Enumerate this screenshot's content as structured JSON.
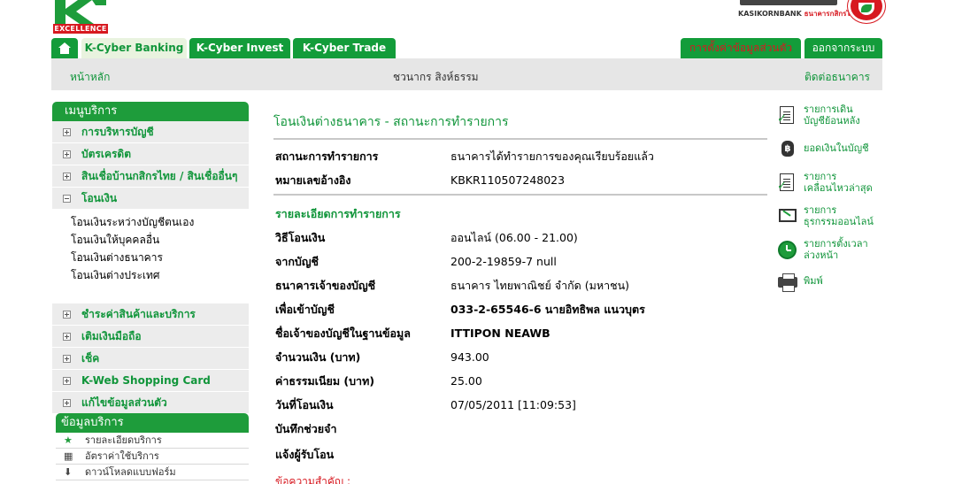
{
  "header": {
    "logo_label": "EXCELLENCE",
    "bank_name_en": "KASIKORNBANK",
    "bank_name_th_small": "ธนาคารกสิกรไทย"
  },
  "tabs": {
    "home_icon": "home-icon",
    "cyber_banking": "K-Cyber Banking",
    "cyber_invest": "K-Cyber Invest",
    "cyber_trade": "K-Cyber Trade",
    "settings": "การตั้งค่าข้อมูลส่วนตัว",
    "logout": "ออกจากระบบ"
  },
  "subbar": {
    "home": "หน้าหลัก",
    "user_name": "ชวนากร สิงห์ธรรม",
    "contact": "ติดต่อธนาคาร"
  },
  "sidebar": {
    "header": "เมนูบริการ",
    "items": [
      {
        "label": "การบริหารบัญชี",
        "toggle": "plus"
      },
      {
        "label": "บัตรเครดิต",
        "toggle": "plus"
      },
      {
        "label": "สินเชื่อบ้านกสิกรไทย / สินเชื่ออื่นๆ",
        "toggle": "plus"
      },
      {
        "label": "โอนเงิน",
        "toggle": "minus"
      }
    ],
    "submenu": [
      "โอนเงินระหว่างบัญชีตนเอง",
      "โอนเงินให้บุคคลอื่น",
      "โอนเงินต่างธนาคาร",
      "โอนเงินต่างประเทศ"
    ],
    "items_after": [
      {
        "label": "ชำระค่าสินค้าและบริการ",
        "toggle": "plus"
      },
      {
        "label": "เติมเงินมือถือ",
        "toggle": "plus"
      },
      {
        "label": "เช็ค",
        "toggle": "plus"
      },
      {
        "label": "K-Web Shopping Card",
        "toggle": "plus"
      },
      {
        "label": "แก้ไขข้อมูลส่วนตัว",
        "toggle": "plus"
      }
    ]
  },
  "info": {
    "header": "ข้อมูลบริการ",
    "items": [
      {
        "label": "รายละเอียดบริการ",
        "icon": "star-icon"
      },
      {
        "label": "อัตราค่าใช้บริการ",
        "icon": "calculator-icon"
      },
      {
        "label": "ดาวน์โหลดแบบฟอร์ม",
        "icon": "download-icon"
      }
    ]
  },
  "main": {
    "title": "โอนเงินต่างธนาคาร - สถานะการทำรายการ",
    "status_rows": [
      {
        "label": "สถานะการทำรายการ",
        "value": "ธนาคารได้ทำรายการของคุณเรียบร้อยแล้ว"
      },
      {
        "label": "หมายเลขอ้างอิง",
        "value": "KBKR110507248023"
      }
    ],
    "detail_title": "รายละเอียดการทำรายการ",
    "detail_rows": [
      {
        "label": "วิธีโอนเงิน",
        "value": "ออนไลน์ (06.00 - 21.00)"
      },
      {
        "label": "จากบัญชี",
        "value": "200-2-19859-7 null"
      },
      {
        "label": "ธนาคารเจ้าของบัญชี",
        "value": "ธนาคาร ไทยพาณิชย์ จำกัด (มหาชน)"
      },
      {
        "label": "เพื่อเข้าบัญชี",
        "value": "033-2-65546-6 นายอิทธิพล แนวบุตร"
      },
      {
        "label": "ชื่อเจ้าของบัญชีในฐานข้อมูล",
        "value": "ITTIPON NEAWB"
      },
      {
        "label": "จำนวนเงิน (บาท)",
        "value": "943.00"
      },
      {
        "label": "ค่าธรรมเนียม (บาท)",
        "value": "25.00"
      },
      {
        "label": "วันที่โอนเงิน",
        "value": "07/05/2011 [11:09:53]"
      },
      {
        "label": "บันทึกช่วยจำ",
        "value": ""
      },
      {
        "label": "แจ้งผู้รับโอน",
        "value": ""
      }
    ],
    "important_note": "ข้อความสำคัญ :"
  },
  "quick_links": [
    {
      "label": "รายการเดิน\nบัญชีย้อนหลัง",
      "icon": "statement-icon"
    },
    {
      "label": "ยอดเงินในบัญชี",
      "icon": "money-bag-icon"
    },
    {
      "label": "รายการ\nเคลื่อนไหวล่าสุด",
      "icon": "recent-transactions-icon"
    },
    {
      "label": "รายการ\nธุรกรรมออนไลน์",
      "icon": "online-transactions-icon"
    },
    {
      "label": "รายการตั้งเวลา\nล่วงหน้า",
      "icon": "clock-icon"
    },
    {
      "label": "พิมพ์",
      "icon": "printer-icon"
    }
  ],
  "colors": {
    "brand_green": "#1e9c3b",
    "accent_red": "#d71920",
    "subbar_gray": "#e6e6e6"
  }
}
